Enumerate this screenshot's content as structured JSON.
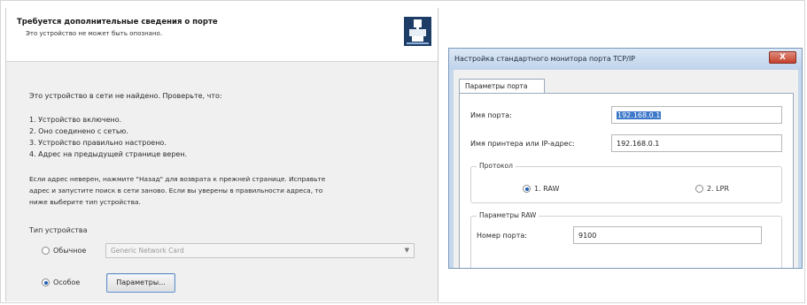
{
  "wizard": {
    "title": "Требуется дополнительные сведения о порте",
    "subtitle": "Это устройство не может быть опознано.",
    "intro": "Это устройство в сети не найдено. Проверьте, что:",
    "checklist": [
      "1. Устройство включено.",
      "2. Оно соединено с сетью.",
      "3. Устройство правильно настроено.",
      "4. Адрес на предыдущей странице верен."
    ],
    "advice_lines": [
      "Если адрес неверен, нажмите \"Назад\" для возврата к прежней странице. Исправьте",
      "адрес и запустите поиск в сети заново. Если вы уверены в правильности адреса, то",
      "ниже выберите тип устройства."
    ],
    "device_type_label": "Тип устройства",
    "option_standard": "Обычное",
    "option_custom": "Особое",
    "selected_option": "custom",
    "standard_dropdown_value": "Generic Network Card",
    "params_button": "Параметры..."
  },
  "dialog": {
    "title": "Настройка стандартного монитора порта TCP/IP",
    "close_label": "X",
    "tab_label": "Параметры порта",
    "port_name_label": "Имя порта:",
    "port_name_value": "192.168.0.1",
    "printer_address_label": "Имя принтера или IP-адрес:",
    "printer_address_value": "192.168.0.1",
    "protocol_group": "Протокол",
    "protocol_raw": "1. RAW",
    "protocol_lpr": "2. LPR",
    "selected_protocol": "raw",
    "raw_settings_group": "Параметры RAW",
    "port_number_label": "Номер порта:",
    "port_number_value": "9100"
  },
  "colors": {
    "accent": "#1f5fb8",
    "selection": "#3d78c9",
    "close_button": "#c4402a",
    "dialog_frame": "#c6d8ec"
  }
}
